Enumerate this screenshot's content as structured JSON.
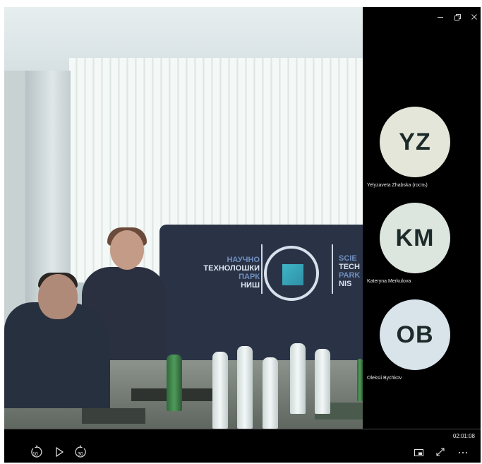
{
  "window": {
    "minimize_icon": "minimize-icon",
    "maximize_icon": "restore-icon",
    "close_icon": "close-icon"
  },
  "participants": [
    {
      "initials": "YZ",
      "name": "Yelyzaveta Zhabska (гость)",
      "color": "#e3e6d8"
    },
    {
      "initials": "KM",
      "name": "Kateryna Merkulova",
      "color": "#dde6de"
    },
    {
      "initials": "OB",
      "name": "Oleksii Bychkov",
      "color": "#d8e4ea"
    }
  ],
  "video": {
    "banner_left_lines": [
      "НАУЧНО",
      "ТЕХНОЛОШКИ",
      "ПАРК",
      "НИШ"
    ],
    "banner_right_lines": [
      "SCIE",
      "TECH",
      "PARK",
      "NIS"
    ]
  },
  "playback": {
    "elapsed": "02:01:08",
    "rewind_label": "10",
    "forward_label": "30"
  }
}
